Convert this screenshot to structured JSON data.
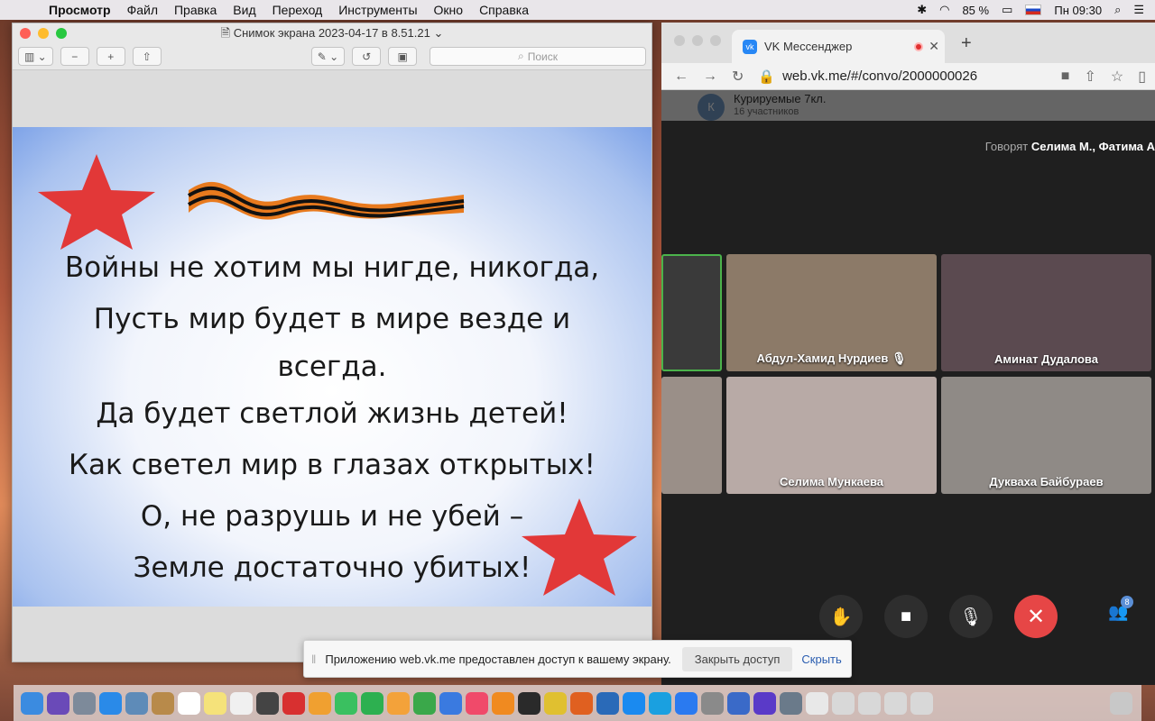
{
  "menubar": {
    "app": "Просмотр",
    "items": [
      "Файл",
      "Правка",
      "Вид",
      "Переход",
      "Инструменты",
      "Окно",
      "Справка"
    ],
    "battery": "85 %",
    "clock": "Пн 09:30"
  },
  "preview": {
    "title": "Снимок экрана 2023-04-17 в 8.51.21",
    "search_placeholder": "Поиск",
    "poem": [
      "Войны не хотим мы нигде, никогда,",
      "Пусть мир будет в мире везде и",
      "всегда.",
      "Да будет светлой жизнь детей!",
      "Как светел мир в глазах открытых!",
      "О, не разрушь и не убей –",
      "Земле достаточно убитых!"
    ]
  },
  "vk": {
    "tab_title": "VK Мессенджер",
    "url": "web.vk.me/#/convo/2000000026",
    "conversation_title": "Курируемые 7кл.",
    "conversation_subtitle": "16 участников",
    "avatar_letter": "К",
    "speaking_prefix": "Говорят",
    "speaking_names": "Селима М., Фатима А",
    "participants": [
      {
        "name": "Абдул-Хамид Нурдиев",
        "muted": true,
        "bg": "#8c7a68"
      },
      {
        "name": "Аминат Дудалова",
        "muted": false,
        "bg": "#5b4a50"
      },
      {
        "name": "Селима Мункаева",
        "muted": false,
        "bg": "#b8aaa6"
      },
      {
        "name": "Дукваха Байбураев",
        "muted": false,
        "bg": "#8f8a86"
      }
    ],
    "participant_count": "8"
  },
  "share_banner": {
    "message": "Приложению web.vk.me предоставлен доступ к вашему экрану.",
    "stop_label": "Закрыть доступ",
    "hide_label": "Скрыть"
  },
  "colors": {
    "accent": "#2787f5",
    "end_call": "#e64646"
  }
}
